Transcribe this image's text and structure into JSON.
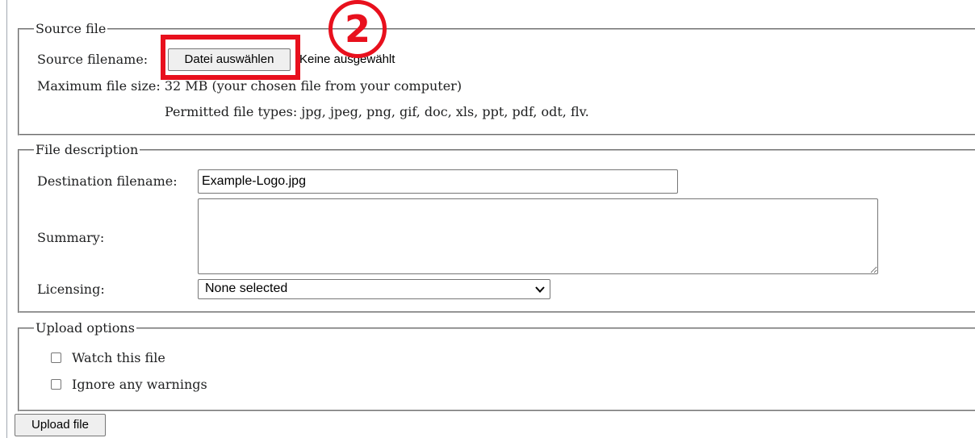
{
  "source_file": {
    "legend": "Source file",
    "filename_label": "Source filename:",
    "choose_button": "Datei auswählen",
    "no_file_text": "Keine ausgewählt",
    "max_size_text": "Maximum file size: 32 MB (your chosen file from your computer)",
    "permitted_types_text": "Permitted file types: jpg, jpeg, png, gif, doc, xls, ppt, pdf, odt, flv."
  },
  "annotation": {
    "step_number": "2",
    "color": "#e8101d"
  },
  "file_description": {
    "legend": "File description",
    "destination_label": "Destination filename:",
    "destination_value": "Example-Logo.jpg",
    "summary_label": "Summary:",
    "summary_value": "",
    "licensing_label": "Licensing:",
    "licensing_selected": "None selected"
  },
  "upload_options": {
    "legend": "Upload options",
    "watch_label": "Watch this file",
    "watch_checked": false,
    "ignore_warnings_label": "Ignore any warnings",
    "ignore_warnings_checked": false
  },
  "submit": {
    "upload_button": "Upload file"
  }
}
